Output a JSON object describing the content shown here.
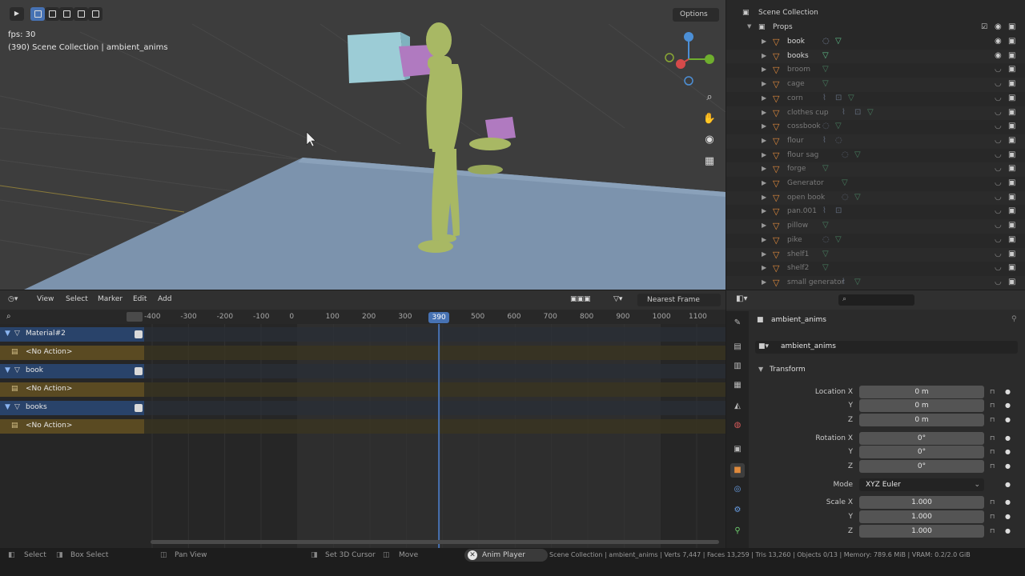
{
  "viewport": {
    "fps_text": "fps: 30",
    "context_text": "(390) Scene Collection | ambient_anims",
    "options_label": "Options",
    "colors": {
      "floor": "#7c93ad",
      "floor_shadow": "#6d849e",
      "character": "#a8b864",
      "box_teal": "#9cccd6",
      "box_pink": "#b07ac0",
      "background": "#3d3d3d"
    }
  },
  "outliner": {
    "scene_collection": "Scene Collection",
    "props_collection": "Props",
    "objects": [
      "book",
      "books",
      "broom",
      "cage",
      "corn",
      "clothes cup",
      "cossbook",
      "flour",
      "flour sag",
      "forge",
      "Generator",
      "open book",
      "pan.001",
      "pillow",
      "pike",
      "shelf1",
      "shelf2",
      "small generator"
    ]
  },
  "dopesheet": {
    "menus": [
      "View",
      "Select",
      "Marker",
      "Edit",
      "Add"
    ],
    "snap_label": "Nearest Frame",
    "frame_ticks": [
      -400,
      -300,
      -200,
      -100,
      0,
      100,
      200,
      300,
      400,
      500,
      600,
      700,
      800,
      900,
      1000,
      1100
    ],
    "ruler_labels": [
      "-400",
      "-300",
      "-200",
      "-100",
      "0",
      "100",
      "200",
      "300",
      "390",
      "500",
      "600",
      "700",
      "800",
      "900",
      "1000",
      "1100"
    ],
    "current_frame": 390,
    "current_frame_label": "390",
    "frame_start": 0,
    "frame_end": 1000,
    "channels": [
      {
        "name": "Material#2",
        "action": "<No Action>"
      },
      {
        "name": "book",
        "action": "<No Action>"
      },
      {
        "name": "books",
        "action": "<No Action>"
      }
    ]
  },
  "properties": {
    "object_name": "ambient_anims",
    "data_name": "ambient_anims",
    "panel_title": "Transform",
    "location": {
      "label_x": "Location X",
      "label_y": "Y",
      "label_z": "Z",
      "x": "0 m",
      "y": "0 m",
      "z": "0 m"
    },
    "rotation": {
      "label_x": "Rotation X",
      "label_y": "Y",
      "label_z": "Z",
      "x": "0°",
      "y": "0°",
      "z": "0°"
    },
    "mode_label": "Mode",
    "mode_value": "XYZ Euler",
    "scale": {
      "label_x": "Scale X",
      "label_y": "Y",
      "label_z": "Z",
      "x": "1.000",
      "y": "1.000",
      "z": "1.000"
    }
  },
  "statusbar": {
    "select": "Select",
    "box_select": "Box Select",
    "pan_view": "Pan View",
    "set_cursor": "Set 3D Cursor",
    "move": "Move",
    "anim_player": "Anim Player",
    "stats": "Scene Collection | ambient_anims | Verts 7,447 | Faces 13,259 | Tris 13,260 | Objects 0/13 | Memory: 789.6 MiB | VRAM: 0.2/2.0 GiB"
  }
}
